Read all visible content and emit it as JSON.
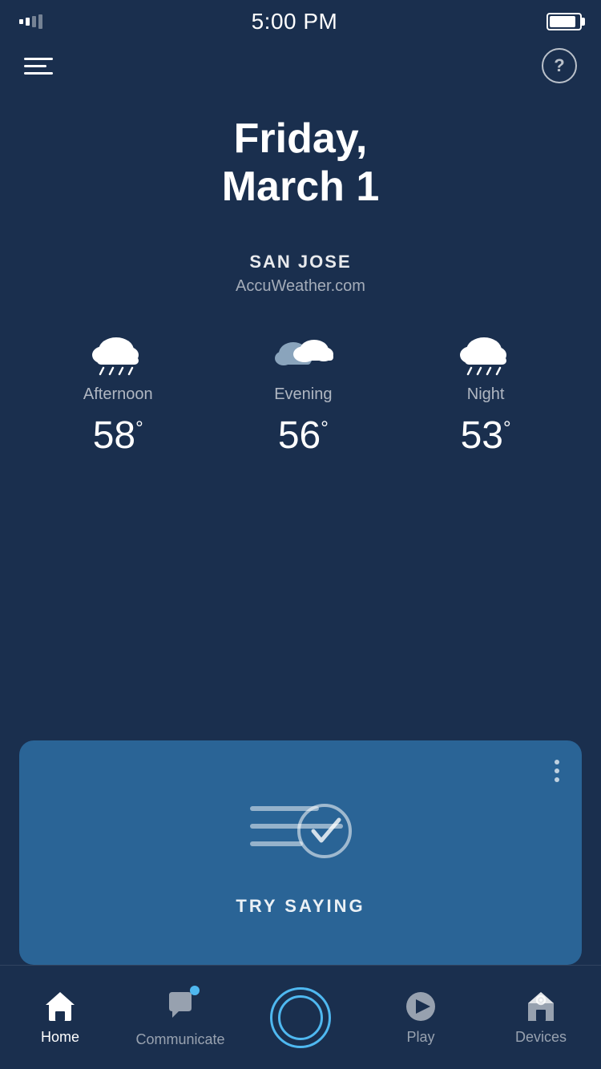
{
  "statusBar": {
    "time": "5:00 PM"
  },
  "topBar": {
    "helpLabel": "?"
  },
  "date": {
    "line1": "Friday,",
    "line2": "March 1"
  },
  "location": {
    "city": "SAN JOSE",
    "source": "AccuWeather.com"
  },
  "weather": [
    {
      "period": "Afternoon",
      "temp": "58",
      "icon": "rain-cloud"
    },
    {
      "period": "Evening",
      "temp": "56",
      "icon": "partly-cloudy"
    },
    {
      "period": "Night",
      "temp": "53",
      "icon": "rain-cloud"
    }
  ],
  "card": {
    "label": "TRY SAYING"
  },
  "bottomNav": {
    "items": [
      {
        "id": "home",
        "label": "Home",
        "active": true
      },
      {
        "id": "communicate",
        "label": "Communicate",
        "active": false
      },
      {
        "id": "alexa",
        "label": "",
        "active": false
      },
      {
        "id": "play",
        "label": "Play",
        "active": false
      },
      {
        "id": "devices",
        "label": "Devices",
        "active": false
      }
    ]
  }
}
